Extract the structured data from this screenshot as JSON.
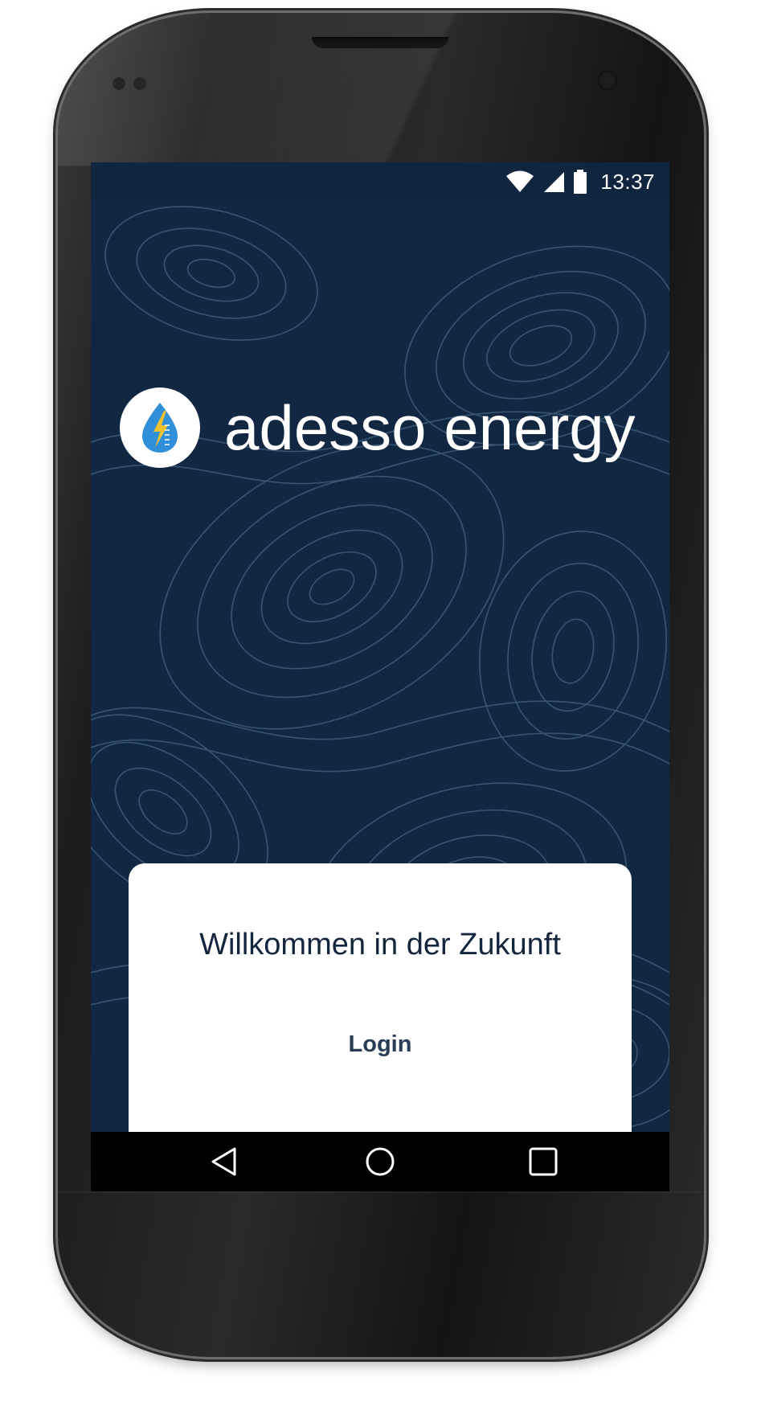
{
  "status_bar": {
    "time": "13:37",
    "icons": [
      "wifi-icon",
      "cell-signal-icon",
      "battery-icon"
    ]
  },
  "brand": {
    "name": "adesso energy",
    "logo_icon": "water-drop-lightning-icon"
  },
  "welcome_card": {
    "title": "Willkommen in der Zukunft",
    "login_label": "Login"
  },
  "nav_bar": {
    "icons": [
      "back-icon",
      "home-icon",
      "recents-icon"
    ]
  },
  "colors": {
    "background": "#122842",
    "topo_lines": "#3e5a7a",
    "card": "#ffffff",
    "title_text": "#14263e",
    "login_text": "#2a3d56",
    "logo_drop": "#2f8fd8",
    "logo_bolt": "#f2c12e"
  }
}
